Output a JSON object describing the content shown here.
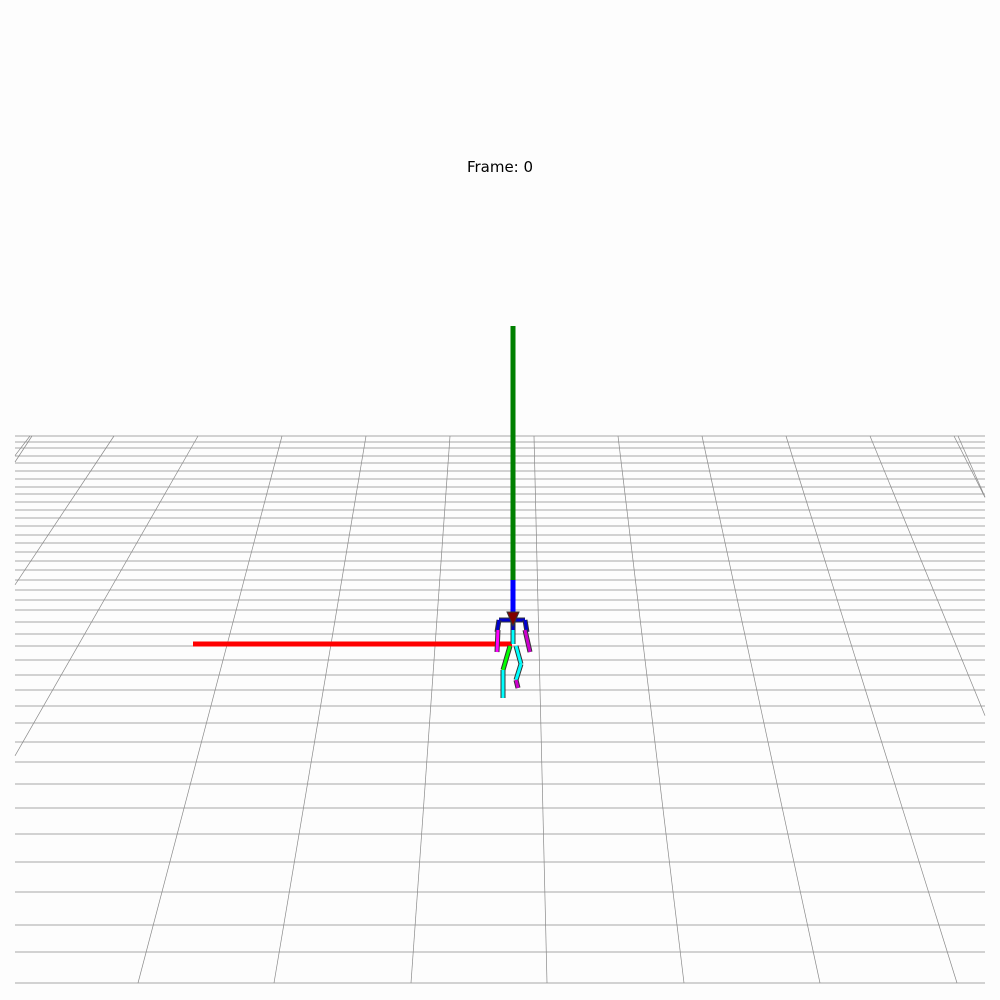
{
  "viewer": {
    "frame_label": "Frame: 0"
  },
  "colors": {
    "background": "#fdfdfd",
    "grid_line": "#8a8a8a",
    "axis_x": "#ff0000",
    "axis_y": "#008000",
    "axis_z": "#0000ff",
    "bone_spine": "#0000cc",
    "bone_arm_left": "#ff00ff",
    "bone_arm_right": "#cc00cc",
    "bone_leg_left": "#00ff00",
    "bone_leg_right": "#00ffff",
    "bone_outline": "#333333",
    "joint_marker": "#800000"
  },
  "icons": [
    "skeleton-figure",
    "world-axes",
    "ground-grid"
  ]
}
